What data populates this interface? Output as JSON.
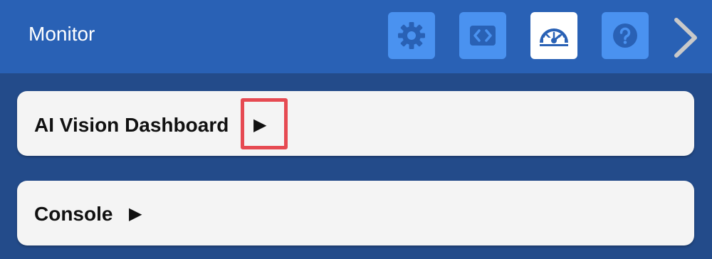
{
  "header": {
    "title": "Monitor",
    "icons": {
      "settings": "gear-icon",
      "code": "code-brackets-icon",
      "dashboard": "speedometer-icon",
      "help": "question-icon",
      "next": "chevron-right-icon"
    }
  },
  "cards": [
    {
      "label": "AI Vision Dashboard",
      "arrow": "▶"
    },
    {
      "label": "Console",
      "arrow": "▶"
    }
  ],
  "colors": {
    "header_bg": "#2961b5",
    "body_bg": "#234b8a",
    "icon_button_bg": "#4a92f0",
    "icon_fg": "#2961b5",
    "card_bg": "#f4f4f4",
    "highlight": "#e64a52"
  }
}
